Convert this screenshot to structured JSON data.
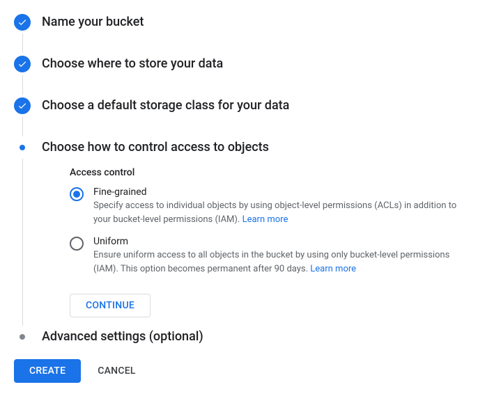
{
  "steps": {
    "name_bucket": "Name your bucket",
    "choose_location": "Choose where to store your data",
    "storage_class": "Choose a default storage class for your data",
    "access_control": "Choose how to control access to objects",
    "advanced": "Advanced settings (optional)"
  },
  "access_control_section": {
    "label": "Access control",
    "fine_grained": {
      "label": "Fine-grained",
      "description_prefix": "Specify access to individual objects by using object-level permissions (ACLs) in addition to your bucket-level permissions (IAM). ",
      "learn_more": "Learn more"
    },
    "uniform": {
      "label": "Uniform",
      "description_prefix": "Ensure uniform access to all objects in the bucket by using only bucket-level permissions (IAM). This option becomes permanent after 90 days. ",
      "learn_more": "Learn more"
    },
    "continue_label": "Continue"
  },
  "buttons": {
    "create": "Create",
    "cancel": "Cancel"
  }
}
